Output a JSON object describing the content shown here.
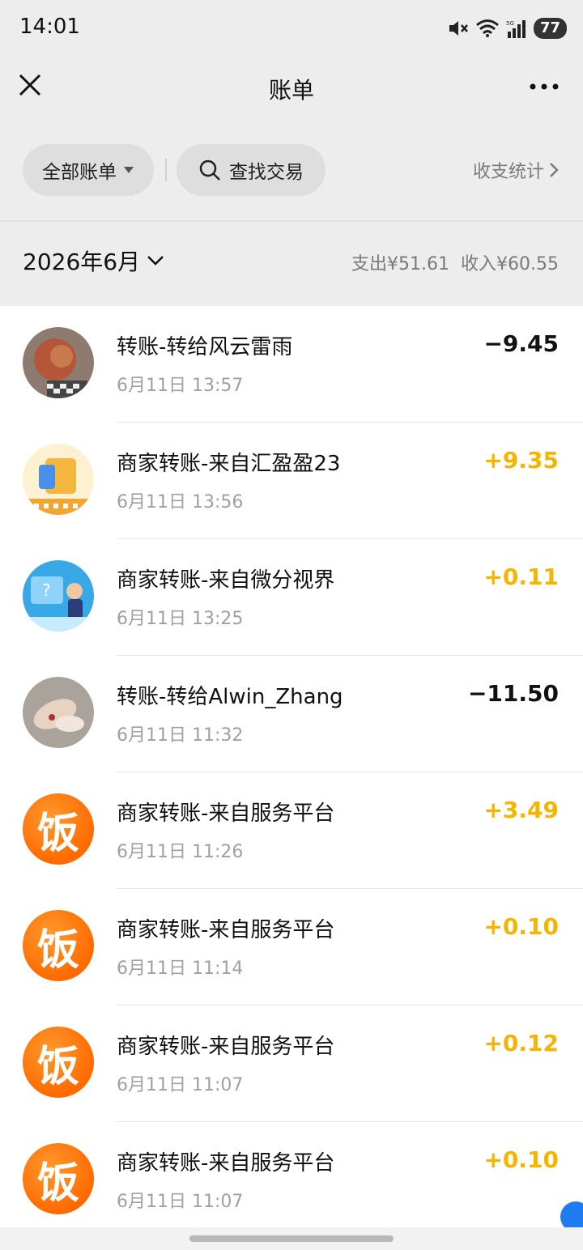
{
  "status": {
    "time": "14:01",
    "battery": "77"
  },
  "header": {
    "title": "账单"
  },
  "filters": {
    "all_bills": "全部账单",
    "search": "查找交易",
    "stats": "收支统计"
  },
  "month": {
    "label": "2026年6月",
    "expense": "支出¥51.61",
    "income": "收入¥60.55"
  },
  "transactions": [
    {
      "title": "转账-转给风云雷雨",
      "time": "6月11日 13:57",
      "amount": "−9.45",
      "sign": "neg",
      "avatar": "photo-ornament"
    },
    {
      "title": "商家转账-来自汇盈盈23",
      "time": "6月11日 13:56",
      "amount": "+9.35",
      "sign": "pos",
      "avatar": "cartoon-bag"
    },
    {
      "title": "商家转账-来自微分视界",
      "time": "6月11日 13:25",
      "amount": "+0.11",
      "sign": "pos",
      "avatar": "cartoon-quiz"
    },
    {
      "title": "转账-转给Alwin_Zhang",
      "time": "6月11日 11:32",
      "amount": "−11.50",
      "sign": "neg",
      "avatar": "photo-hands"
    },
    {
      "title": "商家转账-来自服务平台",
      "time": "6月11日 11:26",
      "amount": "+3.49",
      "sign": "pos",
      "avatar": "fan-logo"
    },
    {
      "title": "商家转账-来自服务平台",
      "time": "6月11日 11:14",
      "amount": "+0.10",
      "sign": "pos",
      "avatar": "fan-logo"
    },
    {
      "title": "商家转账-来自服务平台",
      "time": "6月11日 11:07",
      "amount": "+0.12",
      "sign": "pos",
      "avatar": "fan-logo"
    },
    {
      "title": "商家转账-来自服务平台",
      "time": "6月11日 11:07",
      "amount": "+0.10",
      "sign": "pos",
      "avatar": "fan-logo"
    }
  ],
  "fan_logo_text": "饭",
  "colors": {
    "income": "#f5b400",
    "expense": "#111111",
    "background": "#ededed"
  }
}
